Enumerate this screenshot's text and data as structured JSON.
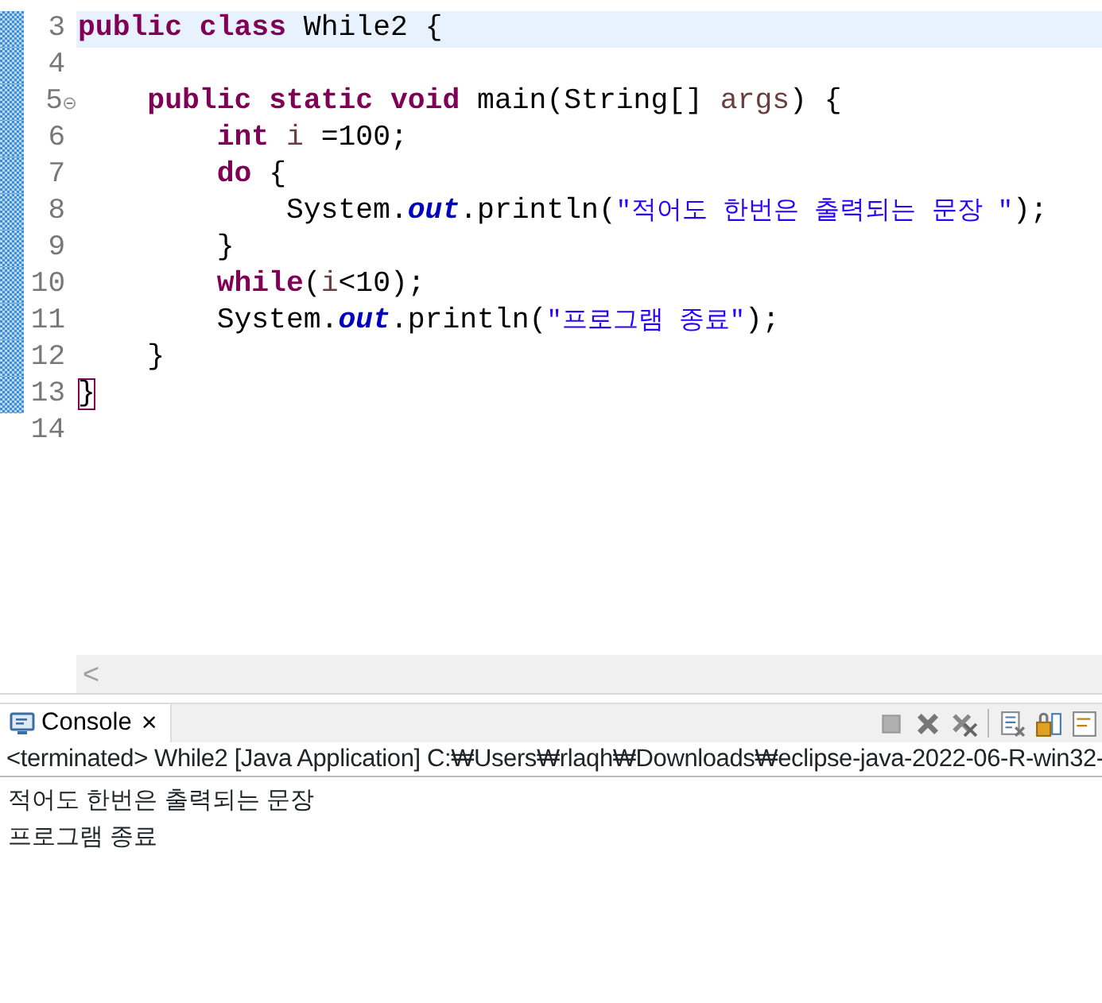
{
  "editor": {
    "lines": [
      {
        "number": "3",
        "current": true,
        "changed": true,
        "foldable": false,
        "tokens": [
          {
            "kind": "keyword",
            "text": "public"
          },
          {
            "kind": "keyword",
            "text": " class"
          },
          {
            "kind": "plain",
            "text": " While2 {"
          }
        ]
      },
      {
        "number": "4",
        "current": false,
        "changed": true,
        "foldable": false
      },
      {
        "number": "5",
        "current": false,
        "changed": true,
        "foldable": true,
        "tokens": [
          {
            "kind": "keyword",
            "text": "    public"
          },
          {
            "kind": "keyword",
            "text": " static"
          },
          {
            "kind": "keyword",
            "text": " void"
          },
          {
            "kind": "plain",
            "text": " main(String[] "
          },
          {
            "kind": "param",
            "text": "args"
          },
          {
            "kind": "plain",
            "text": ") {"
          }
        ]
      },
      {
        "number": "6",
        "current": false,
        "changed": true,
        "foldable": false,
        "tokens": [
          {
            "kind": "keyword",
            "text": "        int"
          },
          {
            "kind": "param",
            "text": " i"
          },
          {
            "kind": "plain",
            "text": " =100;"
          }
        ]
      },
      {
        "number": "7",
        "current": false,
        "changed": true,
        "foldable": false,
        "tokens": [
          {
            "kind": "keyword",
            "text": "        do"
          },
          {
            "kind": "plain",
            "text": " {"
          }
        ]
      },
      {
        "number": "8",
        "current": false,
        "changed": true,
        "foldable": false,
        "tokens": [
          {
            "kind": "plain",
            "text": "            System."
          },
          {
            "kind": "field",
            "text": "out"
          },
          {
            "kind": "plain",
            "text": ".println("
          },
          {
            "kind": "string",
            "text": "\"적어도 한번은 출력되는 문장 \""
          },
          {
            "kind": "plain",
            "text": ");"
          }
        ]
      },
      {
        "number": "9",
        "current": false,
        "changed": true,
        "foldable": false,
        "tokens": [
          {
            "kind": "plain",
            "text": "        }"
          }
        ]
      },
      {
        "number": "10",
        "current": false,
        "changed": true,
        "foldable": false,
        "tokens": [
          {
            "kind": "keyword",
            "text": "        while"
          },
          {
            "kind": "plain",
            "text": "("
          },
          {
            "kind": "param",
            "text": "i"
          },
          {
            "kind": "plain",
            "text": "<10);"
          }
        ]
      },
      {
        "number": "11",
        "current": false,
        "changed": true,
        "foldable": false,
        "tokens": [
          {
            "kind": "plain",
            "text": "        System."
          },
          {
            "kind": "field",
            "text": "out"
          },
          {
            "kind": "plain",
            "text": ".println("
          },
          {
            "kind": "string",
            "text": "\"프로그램 종료\""
          },
          {
            "kind": "plain",
            "text": ");"
          }
        ]
      },
      {
        "number": "12",
        "current": false,
        "changed": true,
        "foldable": false,
        "tokens": [
          {
            "kind": "plain",
            "text": "    }"
          }
        ]
      },
      {
        "number": "13",
        "current": false,
        "changed": true,
        "foldable": false,
        "tokens": [
          {
            "kind": "matched-bracket",
            "text": "}"
          }
        ]
      },
      {
        "number": "14",
        "current": false,
        "changed": false,
        "foldable": false
      }
    ],
    "scroll_left": "<"
  },
  "console": {
    "tab": {
      "label": "Console",
      "close": "×",
      "selected": true
    },
    "toolbar": [
      {
        "kind": "terminate"
      },
      {
        "kind": "remove"
      },
      {
        "kind": "remove-all"
      },
      {
        "kind": "clear"
      },
      {
        "kind": "scroll-lock"
      },
      {
        "kind": "word-wrap"
      }
    ],
    "status": "<terminated> While2 [Java Application] C:₩Users₩rlaqh₩Downloads₩eclipse-java-2022-06-R-win32-",
    "output": [
      "적어도 한번은 출력되는 문장",
      "프로그램 종료"
    ]
  }
}
